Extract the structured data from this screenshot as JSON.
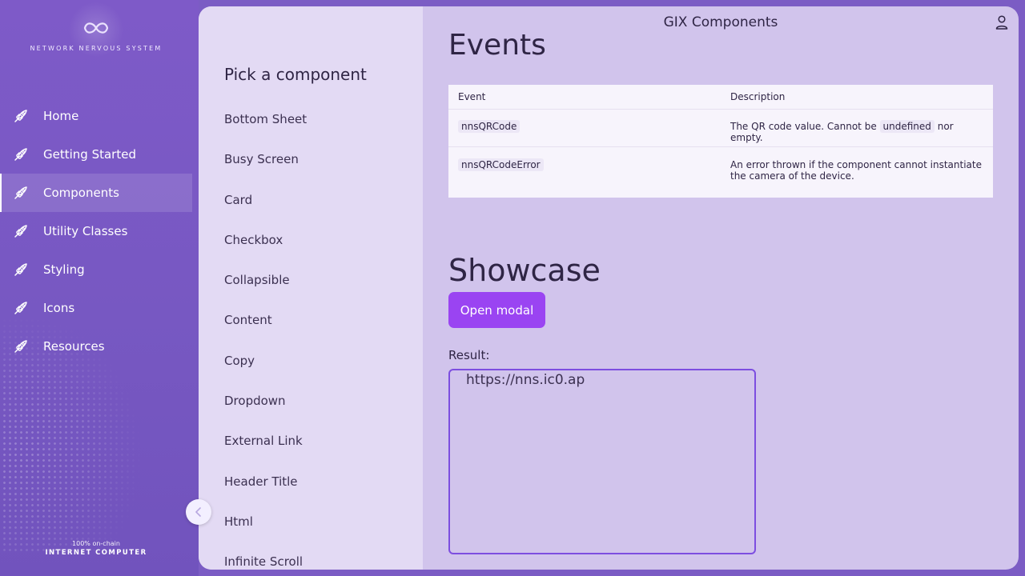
{
  "brand": {
    "name": "NETWORK NERVOUS SYSTEM",
    "logo_icon": "infinity-icon"
  },
  "nav": {
    "items": [
      {
        "label": "Home",
        "icon": "rocket-icon",
        "active": false
      },
      {
        "label": "Getting Started",
        "icon": "rocket-icon",
        "active": false
      },
      {
        "label": "Components",
        "icon": "rocket-icon",
        "active": true
      },
      {
        "label": "Utility Classes",
        "icon": "rocket-icon",
        "active": false
      },
      {
        "label": "Styling",
        "icon": "rocket-icon",
        "active": false
      },
      {
        "label": "Icons",
        "icon": "rocket-icon",
        "active": false
      },
      {
        "label": "Resources",
        "icon": "rocket-icon",
        "active": false
      }
    ]
  },
  "footer": {
    "line1": "100% on-chain",
    "line2": "INTERNET COMPUTER"
  },
  "header": {
    "title": "GIX Components",
    "user_icon": "user-icon"
  },
  "picker": {
    "title": "Pick a component",
    "items": [
      "Bottom Sheet",
      "Busy Screen",
      "Card",
      "Checkbox",
      "Collapsible",
      "Content",
      "Copy",
      "Dropdown",
      "External Link",
      "Header Title",
      "Html",
      "Infinite Scroll"
    ]
  },
  "events": {
    "heading": "Events",
    "columns": [
      "Event",
      "Description"
    ],
    "rows": [
      {
        "event": "nnsQRCode",
        "desc_before": "The QR code value. Cannot be",
        "desc_code": "undefined",
        "desc_after": "nor empty."
      },
      {
        "event": "nnsQRCodeError",
        "desc_before": "An error thrown if the component cannot instantiate the camera of the device.",
        "desc_code": "",
        "desc_after": ""
      }
    ]
  },
  "showcase": {
    "heading": "Showcase",
    "button_label": "Open modal",
    "result_label": "Result:",
    "result_value": "https://nns.ic0.ap"
  },
  "colors": {
    "sidebar": "#7e5ac8",
    "panel": "#d1c4ec",
    "picker": "#e3daf4",
    "primary_button": "#9a44f2",
    "text": "#2f2545"
  }
}
